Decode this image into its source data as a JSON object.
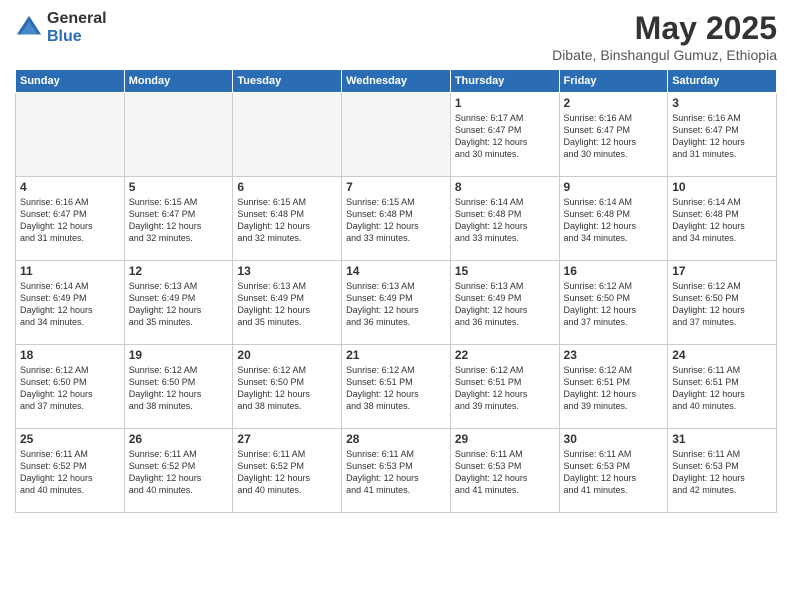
{
  "logo": {
    "general": "General",
    "blue": "Blue"
  },
  "title": "May 2025",
  "subtitle": "Dibate, Binshangul Gumuz, Ethiopia",
  "days_of_week": [
    "Sunday",
    "Monday",
    "Tuesday",
    "Wednesday",
    "Thursday",
    "Friday",
    "Saturday"
  ],
  "weeks": [
    [
      {
        "day": "",
        "info": ""
      },
      {
        "day": "",
        "info": ""
      },
      {
        "day": "",
        "info": ""
      },
      {
        "day": "",
        "info": ""
      },
      {
        "day": "1",
        "info": "Sunrise: 6:17 AM\nSunset: 6:47 PM\nDaylight: 12 hours\nand 30 minutes."
      },
      {
        "day": "2",
        "info": "Sunrise: 6:16 AM\nSunset: 6:47 PM\nDaylight: 12 hours\nand 30 minutes."
      },
      {
        "day": "3",
        "info": "Sunrise: 6:16 AM\nSunset: 6:47 PM\nDaylight: 12 hours\nand 31 minutes."
      }
    ],
    [
      {
        "day": "4",
        "info": "Sunrise: 6:16 AM\nSunset: 6:47 PM\nDaylight: 12 hours\nand 31 minutes."
      },
      {
        "day": "5",
        "info": "Sunrise: 6:15 AM\nSunset: 6:47 PM\nDaylight: 12 hours\nand 32 minutes."
      },
      {
        "day": "6",
        "info": "Sunrise: 6:15 AM\nSunset: 6:48 PM\nDaylight: 12 hours\nand 32 minutes."
      },
      {
        "day": "7",
        "info": "Sunrise: 6:15 AM\nSunset: 6:48 PM\nDaylight: 12 hours\nand 33 minutes."
      },
      {
        "day": "8",
        "info": "Sunrise: 6:14 AM\nSunset: 6:48 PM\nDaylight: 12 hours\nand 33 minutes."
      },
      {
        "day": "9",
        "info": "Sunrise: 6:14 AM\nSunset: 6:48 PM\nDaylight: 12 hours\nand 34 minutes."
      },
      {
        "day": "10",
        "info": "Sunrise: 6:14 AM\nSunset: 6:48 PM\nDaylight: 12 hours\nand 34 minutes."
      }
    ],
    [
      {
        "day": "11",
        "info": "Sunrise: 6:14 AM\nSunset: 6:49 PM\nDaylight: 12 hours\nand 34 minutes."
      },
      {
        "day": "12",
        "info": "Sunrise: 6:13 AM\nSunset: 6:49 PM\nDaylight: 12 hours\nand 35 minutes."
      },
      {
        "day": "13",
        "info": "Sunrise: 6:13 AM\nSunset: 6:49 PM\nDaylight: 12 hours\nand 35 minutes."
      },
      {
        "day": "14",
        "info": "Sunrise: 6:13 AM\nSunset: 6:49 PM\nDaylight: 12 hours\nand 36 minutes."
      },
      {
        "day": "15",
        "info": "Sunrise: 6:13 AM\nSunset: 6:49 PM\nDaylight: 12 hours\nand 36 minutes."
      },
      {
        "day": "16",
        "info": "Sunrise: 6:12 AM\nSunset: 6:50 PM\nDaylight: 12 hours\nand 37 minutes."
      },
      {
        "day": "17",
        "info": "Sunrise: 6:12 AM\nSunset: 6:50 PM\nDaylight: 12 hours\nand 37 minutes."
      }
    ],
    [
      {
        "day": "18",
        "info": "Sunrise: 6:12 AM\nSunset: 6:50 PM\nDaylight: 12 hours\nand 37 minutes."
      },
      {
        "day": "19",
        "info": "Sunrise: 6:12 AM\nSunset: 6:50 PM\nDaylight: 12 hours\nand 38 minutes."
      },
      {
        "day": "20",
        "info": "Sunrise: 6:12 AM\nSunset: 6:50 PM\nDaylight: 12 hours\nand 38 minutes."
      },
      {
        "day": "21",
        "info": "Sunrise: 6:12 AM\nSunset: 6:51 PM\nDaylight: 12 hours\nand 38 minutes."
      },
      {
        "day": "22",
        "info": "Sunrise: 6:12 AM\nSunset: 6:51 PM\nDaylight: 12 hours\nand 39 minutes."
      },
      {
        "day": "23",
        "info": "Sunrise: 6:12 AM\nSunset: 6:51 PM\nDaylight: 12 hours\nand 39 minutes."
      },
      {
        "day": "24",
        "info": "Sunrise: 6:11 AM\nSunset: 6:51 PM\nDaylight: 12 hours\nand 40 minutes."
      }
    ],
    [
      {
        "day": "25",
        "info": "Sunrise: 6:11 AM\nSunset: 6:52 PM\nDaylight: 12 hours\nand 40 minutes."
      },
      {
        "day": "26",
        "info": "Sunrise: 6:11 AM\nSunset: 6:52 PM\nDaylight: 12 hours\nand 40 minutes."
      },
      {
        "day": "27",
        "info": "Sunrise: 6:11 AM\nSunset: 6:52 PM\nDaylight: 12 hours\nand 40 minutes."
      },
      {
        "day": "28",
        "info": "Sunrise: 6:11 AM\nSunset: 6:53 PM\nDaylight: 12 hours\nand 41 minutes."
      },
      {
        "day": "29",
        "info": "Sunrise: 6:11 AM\nSunset: 6:53 PM\nDaylight: 12 hours\nand 41 minutes."
      },
      {
        "day": "30",
        "info": "Sunrise: 6:11 AM\nSunset: 6:53 PM\nDaylight: 12 hours\nand 41 minutes."
      },
      {
        "day": "31",
        "info": "Sunrise: 6:11 AM\nSunset: 6:53 PM\nDaylight: 12 hours\nand 42 minutes."
      }
    ]
  ]
}
